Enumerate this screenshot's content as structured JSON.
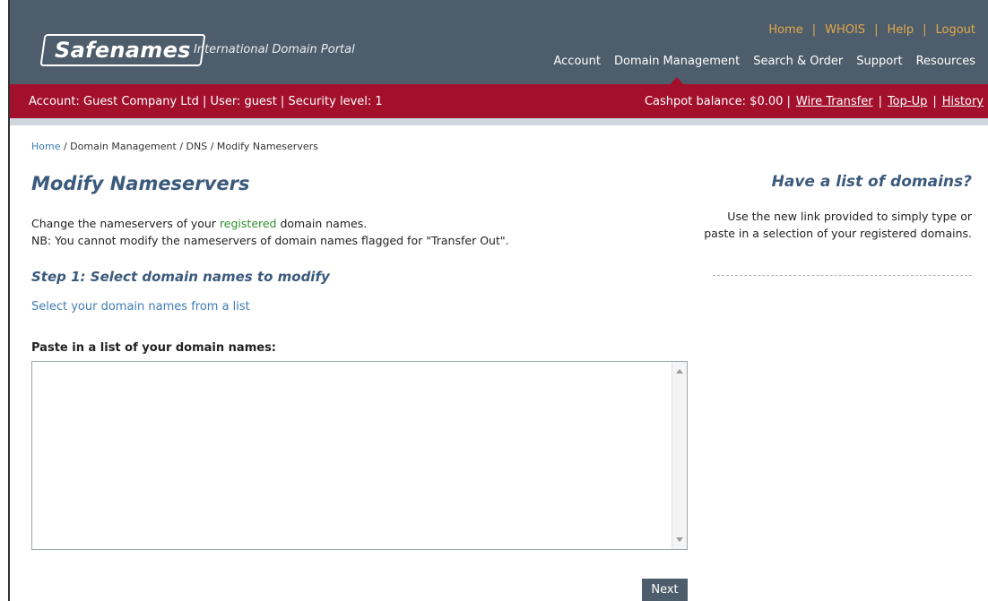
{
  "brand": {
    "logo": "Safenames",
    "tagline": "International Domain Portal"
  },
  "top_links": [
    "Home",
    "WHOIS",
    "Help",
    "Logout"
  ],
  "main_nav": [
    {
      "label": "Account",
      "active": false
    },
    {
      "label": "Domain Management",
      "active": true
    },
    {
      "label": "Search & Order",
      "active": false
    },
    {
      "label": "Support",
      "active": false
    },
    {
      "label": "Resources",
      "active": false
    }
  ],
  "account_bar": {
    "info": "Account: Guest Company Ltd | User: guest | Security level: 1",
    "cashpot": "Cashpot balance: $0.00 |",
    "wire_transfer": "Wire Transfer",
    "topup": "Top-Up",
    "history": "History"
  },
  "breadcrumb": {
    "home": "Home",
    "rest": " / Domain Management / DNS / Modify Nameservers"
  },
  "page": {
    "title": "Modify Nameservers",
    "intro_pre": "Change the nameservers of your ",
    "intro_green": "registered",
    "intro_post": " domain names.",
    "intro_note": "NB: You cannot modify the nameservers of domain names flagged for \"Transfer Out\".",
    "step_title": "Step 1: Select domain names to modify",
    "select_link": "Select your domain names from a list",
    "paste_label": "Paste in a list of your domain names:",
    "textarea_value": "",
    "next_label": "Next"
  },
  "sidebar": {
    "title": "Have a list of domains?",
    "text": "Use the new link provided to simply type or paste in a selection of your registered domains."
  },
  "colors": {
    "header": "#4e5d6b",
    "account_bar": "#a3102c",
    "title": "#3b5a7c",
    "link": "#3f7cb3",
    "top_links": "#e0a94a"
  }
}
